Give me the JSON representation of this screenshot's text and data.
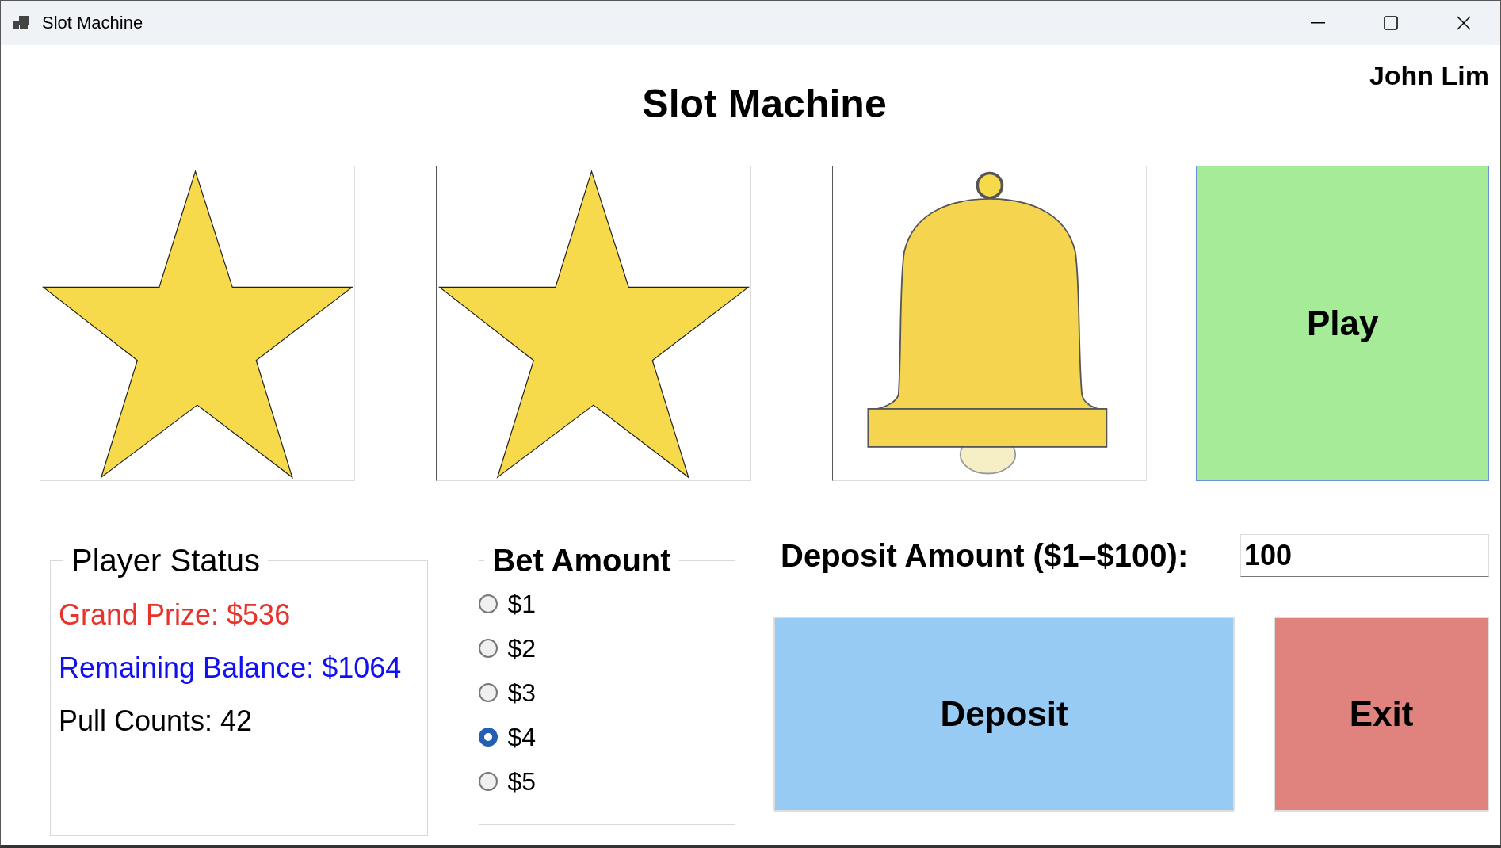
{
  "window": {
    "title": "Slot Machine"
  },
  "player_name": "John Lim",
  "heading": "Slot Machine",
  "reels": [
    {
      "kind": "star"
    },
    {
      "kind": "star"
    },
    {
      "kind": "bell"
    }
  ],
  "play_button": "Play",
  "player_status": {
    "legend": "Player Status",
    "lines": [
      {
        "text": "Grand Prize: $536",
        "color": "#e8322a"
      },
      {
        "text": "Remaining Balance: $1064",
        "color": "#1010f0"
      },
      {
        "text": "Pull Counts: 42",
        "color": "#000000"
      }
    ]
  },
  "bet_amount": {
    "legend": "Bet Amount",
    "options": [
      {
        "label": "$1",
        "selected": false
      },
      {
        "label": "$2",
        "selected": false
      },
      {
        "label": "$3",
        "selected": false
      },
      {
        "label": "$4",
        "selected": true
      },
      {
        "label": "$5",
        "selected": false
      }
    ]
  },
  "deposit": {
    "label": "Deposit Amount ($1–$100):",
    "value": "100",
    "button": "Deposit"
  },
  "exit_button": "Exit"
}
